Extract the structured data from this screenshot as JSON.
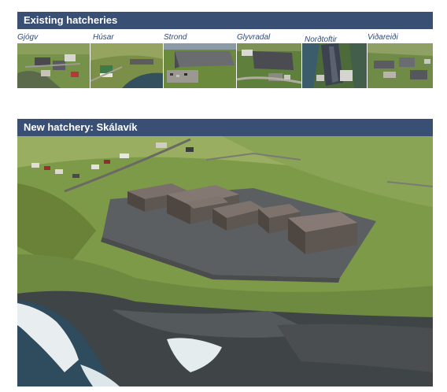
{
  "existing": {
    "heading": "Existing hatcheries",
    "sites": [
      {
        "name": "Gjógv"
      },
      {
        "name": "Húsar"
      },
      {
        "name": "Strond"
      },
      {
        "name": "Glyvradal"
      },
      {
        "name": "Norðtoftir"
      },
      {
        "name": "Viðareiði"
      }
    ]
  },
  "new_hatchery": {
    "heading": "New hatchery: Skálavík"
  },
  "colors": {
    "header_bar": "#3a4f74",
    "caption_text": "#2e4a78",
    "grass": "#6f8a3a",
    "sea": "#2f4b5e",
    "building_roof": "#7a6f6a"
  }
}
